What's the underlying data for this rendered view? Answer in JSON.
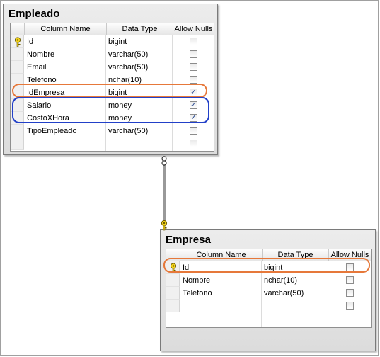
{
  "diagram": {
    "empleado": {
      "title": "Empleado",
      "headers": {
        "name": "Column Name",
        "type": "Data Type",
        "nulls": "Allow Nulls"
      },
      "columns": [
        {
          "name": "Id",
          "type": "bigint",
          "allow_nulls": false,
          "primary_key": true
        },
        {
          "name": "Nombre",
          "type": "varchar(50)",
          "allow_nulls": false,
          "primary_key": false
        },
        {
          "name": "Email",
          "type": "varchar(50)",
          "allow_nulls": false,
          "primary_key": false
        },
        {
          "name": "Telefono",
          "type": "nchar(10)",
          "allow_nulls": false,
          "primary_key": false
        },
        {
          "name": "IdEmpresa",
          "type": "bigint",
          "allow_nulls": true,
          "primary_key": false
        },
        {
          "name": "Salario",
          "type": "money",
          "allow_nulls": true,
          "primary_key": false
        },
        {
          "name": "CostoXHora",
          "type": "money",
          "allow_nulls": true,
          "primary_key": false
        },
        {
          "name": "TipoEmpleado",
          "type": "varchar(50)",
          "allow_nulls": false,
          "primary_key": false
        },
        {
          "name": "",
          "type": "",
          "allow_nulls": false,
          "primary_key": false
        }
      ]
    },
    "empresa": {
      "title": "Empresa",
      "headers": {
        "name": "Column Name",
        "type": "Data Type",
        "nulls": "Allow Nulls"
      },
      "columns": [
        {
          "name": "Id",
          "type": "bigint",
          "allow_nulls": false,
          "primary_key": true
        },
        {
          "name": "Nombre",
          "type": "nchar(10)",
          "allow_nulls": false,
          "primary_key": false
        },
        {
          "name": "Telefono",
          "type": "varchar(50)",
          "allow_nulls": false,
          "primary_key": false
        },
        {
          "name": "",
          "type": "",
          "allow_nulls": false,
          "primary_key": false
        }
      ]
    },
    "colors": {
      "highlight_orange": "#e6783a",
      "highlight_blue": "#2240c8",
      "key_icon": "#f2d21a"
    },
    "relationship": {
      "from": "Empleado",
      "to": "Empresa"
    }
  }
}
